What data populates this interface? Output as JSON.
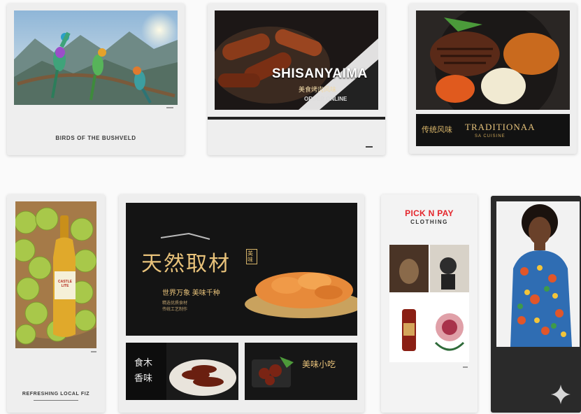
{
  "displays": {
    "birds": {
      "caption": "BIRDS OF THE BUSHVELD"
    },
    "grill": {
      "brand": "SHISANYAIMA",
      "subtitle": "美食烤肉风味",
      "tagline": "ORDER ONLINE"
    },
    "steak": {
      "left_label": "传统风味",
      "title": "TRADITIONAA",
      "subtitle": "SA CUISINE"
    },
    "beer": {
      "caption": "REFRESHING LOCAL FIZ",
      "bottle_label": "CASTLE LITE"
    },
    "snack": {
      "headline": "天然取材",
      "seal": "美味",
      "line1": "世界万象 美味千种",
      "line2": "精选优质食材",
      "line3": "传统工艺制作",
      "tile_text": "食木 香味",
      "tile2_text": "美味小吃"
    },
    "pnp": {
      "brand": "PICK N PAY",
      "sub": "CLOTHING"
    }
  },
  "colors": {
    "pnp_red": "#e4262c",
    "gold": "#d8b56a",
    "page_bg": "#fafafa"
  },
  "icons": {
    "corner": "sparkle-icon"
  }
}
